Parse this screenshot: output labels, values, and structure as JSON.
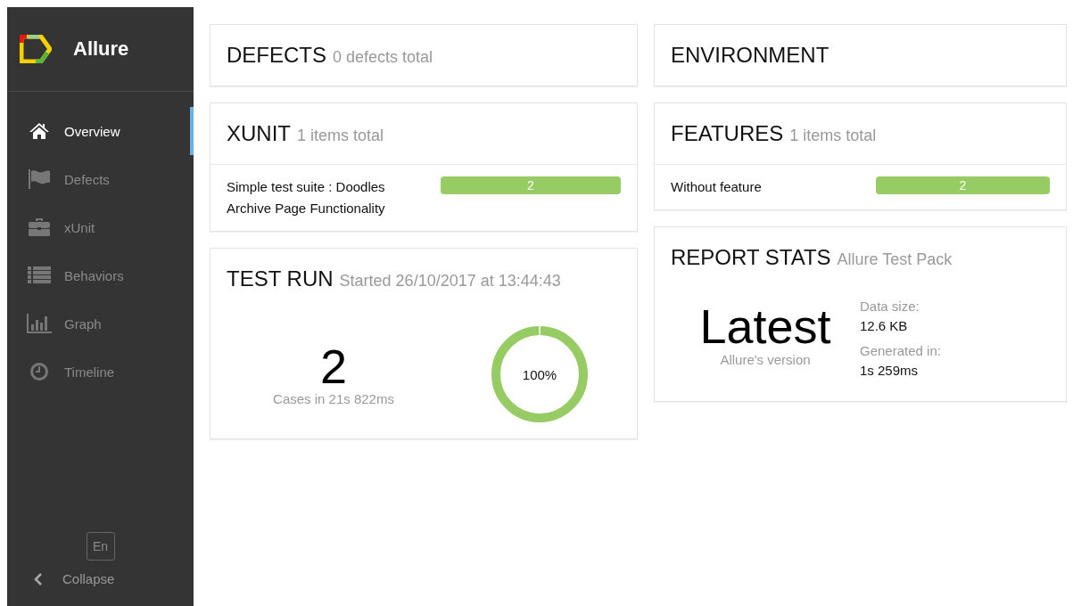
{
  "sidebar": {
    "brand": "Allure",
    "items": [
      {
        "label": "Overview",
        "selected": true
      },
      {
        "label": "Defects",
        "selected": false
      },
      {
        "label": "xUnit",
        "selected": false
      },
      {
        "label": "Behaviors",
        "selected": false
      },
      {
        "label": "Graph",
        "selected": false
      },
      {
        "label": "Timeline",
        "selected": false
      }
    ],
    "language": "En",
    "collapse": "Collapse"
  },
  "columns": [
    [
      {
        "kind": "header",
        "title": "DEFECTS",
        "subtitle": "0 defects total"
      },
      {
        "kind": "bars",
        "title": "XUNIT",
        "subtitle": "1 items total",
        "rows": [
          {
            "name": "Simple test suite : Doodles Archive Page Functionality",
            "count": "2",
            "color": "#97cc64"
          }
        ]
      },
      {
        "kind": "run",
        "title": "TEST RUN",
        "subtitle": "Started 26/10/2017 at 13:44:43",
        "cases": "2",
        "duration": "Cases in 21s 822ms",
        "percent": "100%",
        "level": 1
      }
    ],
    [
      {
        "kind": "header",
        "title": "ENVIRONMENT"
      },
      {
        "kind": "bars",
        "title": "FEATURES",
        "subtitle": "1 items total",
        "rows": [
          {
            "name": "Without feature",
            "count": "2",
            "color": "#97cc64"
          }
        ]
      },
      {
        "kind": "stats",
        "title": "REPORT STATS",
        "subtitle": "Allure Test Pack",
        "version": "Latest",
        "version_label": "Allure's version",
        "stats": [
          {
            "label": "Data size:",
            "value": "12.6 KB"
          },
          {
            "label": "Generated in:",
            "value": "1s 259ms"
          }
        ]
      }
    ]
  ]
}
